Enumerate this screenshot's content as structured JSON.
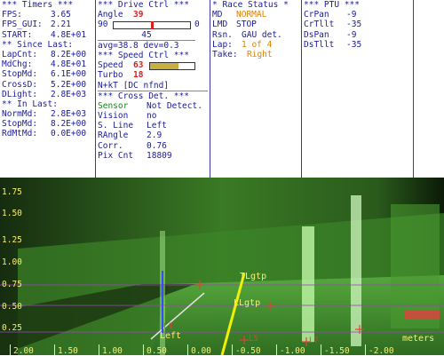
{
  "timers": {
    "title": "*** Timers ***",
    "fps_label": "FPS:",
    "fps": "3.65",
    "fps_gui_label": "FPS_GUI:",
    "fps_gui": "2.21",
    "start_label": "START:",
    "start": "4.8E+01",
    "since_title": "** Since Last:",
    "lapcnt_label": "LapCnt:",
    "lapcnt": "8.2E+00",
    "mdchg_label": "MdChg:",
    "mdchg": "4.8E+01",
    "stopmd_label": "StopMd:",
    "stopmd": "6.1E+00",
    "crossd_label": "CrossD:",
    "crossd": "5.2E+00",
    "dlight_label": "DLight:",
    "dlight": "2.8E+03",
    "inlast_title": "** In Last:",
    "normmd_label": "NormMd:",
    "normmd": "2.8E+03",
    "stopmd2_label": "StopMd:",
    "stopmd2": "8.2E+00",
    "rdmtmd_label": "RdMtMd:",
    "rdmtmd": "0.0E+00"
  },
  "drive": {
    "title": "***  Drive Ctrl  ***",
    "angle_label": "Angle",
    "angle": "39",
    "slider_min": "90",
    "slider_max": "0",
    "slider_value": "45",
    "slider_fraction": 0.5,
    "avg_dev": "avg=38.8  dev=0.3",
    "speed_title": "***  Speed Ctrl  ***",
    "speed_label": "Speed",
    "speed": "63",
    "speed_fraction": 0.63,
    "turbo_label": "Turbo",
    "turbo": "18",
    "nkt": "N+kT [DC nfnd]",
    "cross_title": "*** Cross Det. ***",
    "sensor_label": "Sensor",
    "sensor": "Not Detect.",
    "vision_label": "Vision",
    "vision": "no",
    "sline_label": "S. Line",
    "sline": "Left",
    "rangle_label": "RAngle",
    "rangle": "2.9",
    "corr_label": "Corr.",
    "corr": "0.76",
    "pixcnt_label": "Pix Cnt",
    "pixcnt": "18809"
  },
  "race": {
    "title": "* Race Status *",
    "md_label": "MD",
    "md": "NORMAL",
    "lmd_label": "LMD",
    "lmd": "STOP",
    "rsn_label": "Rsn.",
    "rsn": "GAU det.",
    "lap_label": "Lap:",
    "lap": "1 of 4",
    "take_label": "Take:",
    "take": "Right"
  },
  "ptu": {
    "title": "*** PTU ***",
    "crpan_label": "CrPan",
    "crpan": "-9",
    "crtilt_label": "CrTllt",
    "crtilt": "-35",
    "dspan_label": "DsPan",
    "dspan": "-9",
    "dstilt_label": "DsTllt",
    "dstilt": "-35"
  },
  "camera": {
    "y_ticks": [
      "1.75",
      "1.50",
      "1.25",
      "1.00",
      "0.75",
      "0.50",
      "0.25"
    ],
    "x_ticks": [
      "2.00",
      "1.50",
      "1.00",
      "0.50",
      "0.00",
      "-0.50",
      "-1.00",
      "-1.50",
      "-2.00"
    ],
    "unit": "meters",
    "label_tlgtp": "TLgtp",
    "label_llgtp": "LLgtp",
    "label_left": "Left",
    "label_ls": "L5",
    "label_l1": "L1",
    "label_l7": "L7"
  },
  "colors": {
    "label_blue": "#1a1a9a",
    "value_red": "#d42020",
    "value_orange": "#e08000",
    "sensor_green": "#109010",
    "overlay_yellow": "#f8f070"
  }
}
